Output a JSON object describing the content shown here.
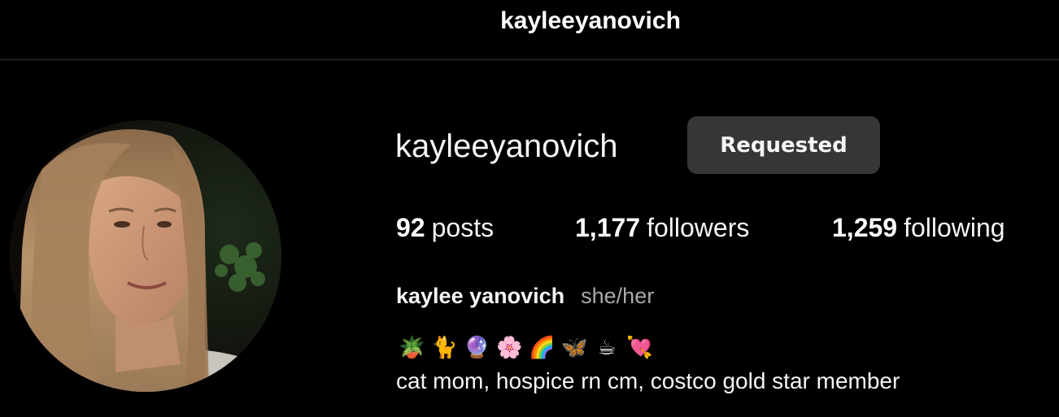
{
  "header": {
    "title": "kayleeyanovich"
  },
  "profile": {
    "username": "kayleeyanovich",
    "follow_button_label": "Requested",
    "stats": {
      "posts_count": "92",
      "posts_label": "posts",
      "followers_count": "1,177",
      "followers_label": "followers",
      "following_count": "1,259",
      "following_label": "following"
    },
    "full_name": "kaylee yanovich",
    "pronouns": "she/her",
    "bio_emojis": [
      "🪴",
      "🐈",
      "🔮",
      "🌸",
      "🌈",
      "🦋",
      "☕",
      "💘"
    ],
    "bio_text": "cat mom, hospice rn cm, costco gold star member"
  },
  "colors": {
    "background": "#000000",
    "button_bg": "#363636",
    "secondary_text": "#a8a8a8",
    "divider": "#363636"
  }
}
